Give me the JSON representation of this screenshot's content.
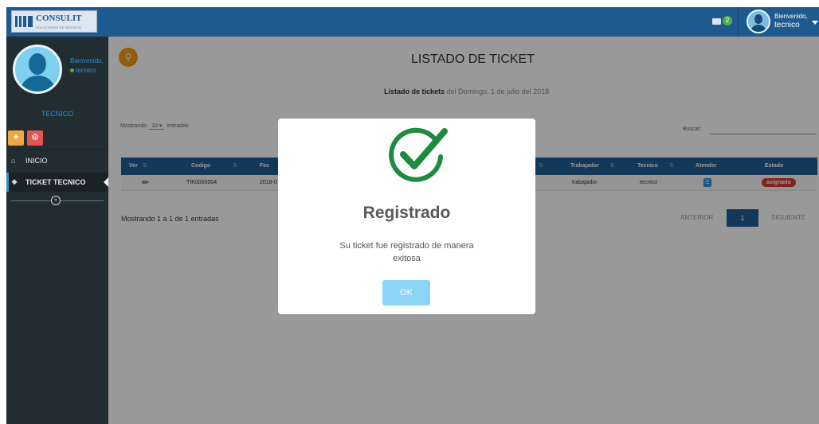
{
  "header": {
    "logo_text": "CONSULIT",
    "logo_sub": "SOLUCIONES DE NEGOCIO",
    "mail_count": "2",
    "user_greeting": "Bienvenido,",
    "user_name": "tecnico"
  },
  "sidebar": {
    "greeting": "Bienvenido,",
    "status": "tecnico",
    "role": "TECNICO",
    "items": [
      {
        "label": "INICIO"
      },
      {
        "label": "TICKET TECNICO"
      }
    ]
  },
  "main": {
    "title": "LISTADO DE TICKET",
    "subtitle_bold": "Listado de tickets",
    "subtitle_date": "del Domingo, 1 de julio del 2018",
    "length_prefix": "Mostrando",
    "length_value": "10",
    "length_suffix": "entradas",
    "search_label": "Buscar:",
    "columns": [
      "Ver",
      "Codigo",
      "Fec",
      "Trabajador",
      "Tecnico",
      "Atender",
      "Estado"
    ],
    "rows": [
      {
        "codigo": "TIK0000004",
        "fecha": "2018-0",
        "trabajador": "trabajador",
        "tecnico": "tecnico",
        "estado": "asignado"
      }
    ],
    "info": "Mostrando 1 a 1 de 1 entradas",
    "pagination": {
      "prev": "ANTERIOR",
      "current": "1",
      "next": "SIGUIENTE"
    }
  },
  "modal": {
    "title": "Registrado",
    "message": "Su ticket fue registrado de manera exitosa",
    "ok_label": "OK"
  },
  "colors": {
    "topbar": "#1e5a8e",
    "sidebar": "#222d32",
    "table_header": "#215e96",
    "success_green": "#1f8b3f",
    "ok_button": "#8cd4f5",
    "badge_red": "#d73a3a"
  }
}
